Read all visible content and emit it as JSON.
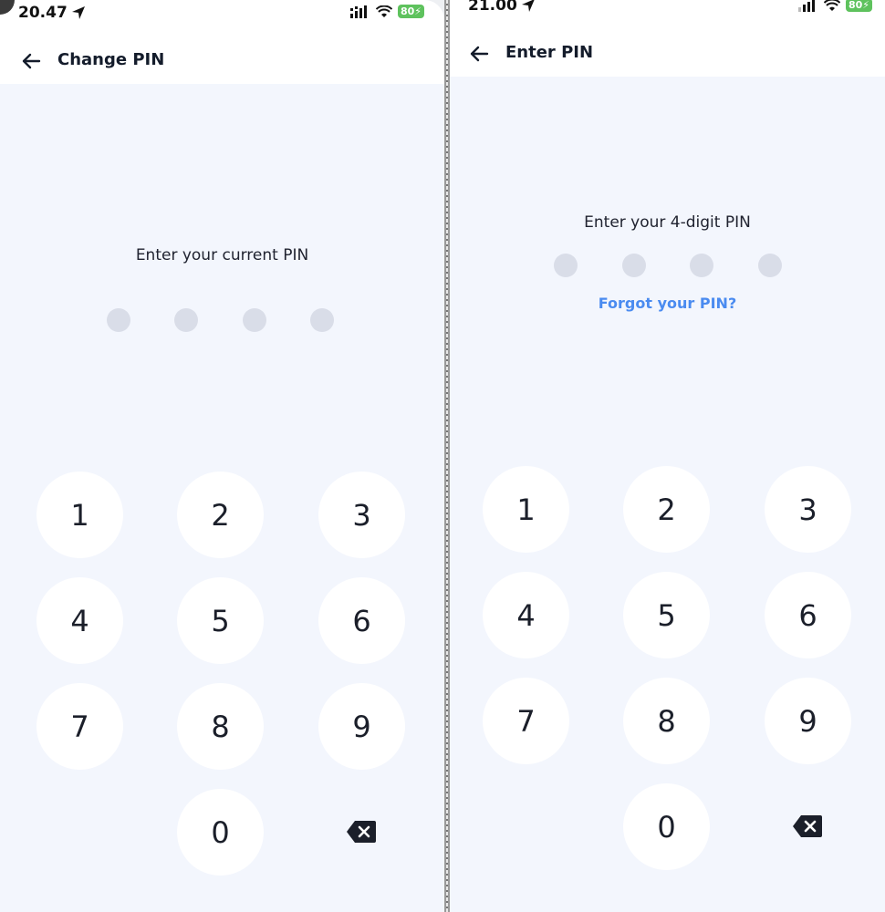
{
  "left_screen": {
    "status_time": "20.47",
    "battery": "80",
    "title": "Change PIN",
    "prompt": "Enter your current PIN",
    "keys": [
      "1",
      "2",
      "3",
      "4",
      "5",
      "6",
      "7",
      "8",
      "9",
      "0"
    ]
  },
  "right_screen": {
    "status_time": "21.00",
    "battery": "80",
    "title": "Enter PIN",
    "prompt": "Enter your 4-digit PIN",
    "forgot": "Forgot your PIN?",
    "keys": [
      "1",
      "2",
      "3",
      "4",
      "5",
      "6",
      "7",
      "8",
      "9",
      "0"
    ]
  },
  "icons": {
    "back": "arrow-left-icon",
    "location": "location-arrow-icon",
    "signal": "signal-icon",
    "wifi": "wifi-icon",
    "battery": "battery-charging-icon",
    "delete": "backspace-icon"
  },
  "colors": {
    "background": "#f3f6fd",
    "dot": "#d9dde8",
    "link": "#4a8bf0",
    "battery": "#5ec25d"
  }
}
